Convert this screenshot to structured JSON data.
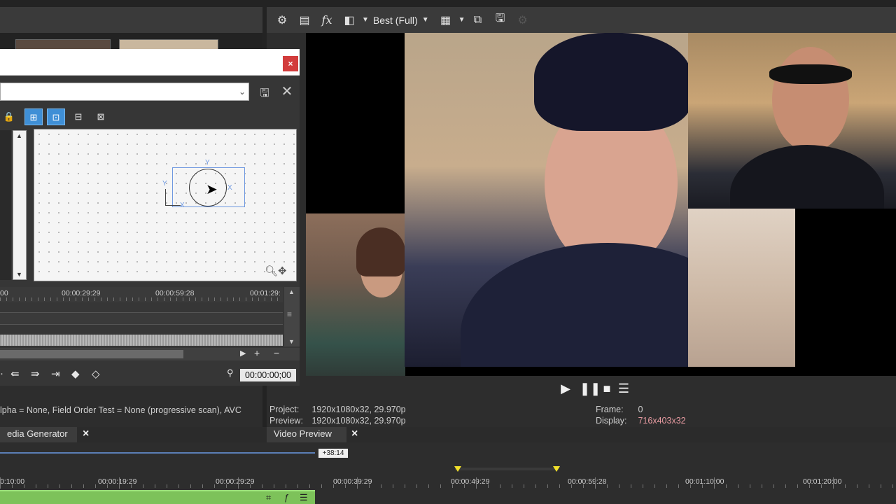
{
  "preview_toolbar": {
    "settings_icon": "gear-icon",
    "preview_quality": "Best (Full)",
    "fx_label": "fx"
  },
  "video_preview": {
    "project_label": "Project:",
    "project_value": "1920x1080x32, 29.970p",
    "preview_label": "Preview:",
    "preview_value": "1920x1080x32, 29.970p",
    "frame_label": "Frame:",
    "frame_value": "0",
    "display_label": "Display:",
    "display_value": "716x403x32",
    "display_color": "#e59aa0"
  },
  "left_status": {
    "text": "lpha = None, Field Order Test = None (progressive scan), AVC"
  },
  "tabs": {
    "media_generator": "edia Generator",
    "video_preview": "Video Preview"
  },
  "timeline": {
    "marker": "+38:14",
    "ruler": [
      "0:10:00",
      "00:00:19:29",
      "00:00:29:29",
      "00:00:39:29",
      "00:00:49:29",
      "00:00:59:28",
      "00:01:10:00",
      "00:01:20:00"
    ]
  },
  "pan_crop_dialog": {
    "close_label": "×",
    "axis_y": "Y",
    "axis_x": "X",
    "ruler": [
      "00",
      "00:00:29:29",
      "00:00:59:28",
      "00:01:29:"
    ],
    "timecode": "00:00:00;00"
  }
}
